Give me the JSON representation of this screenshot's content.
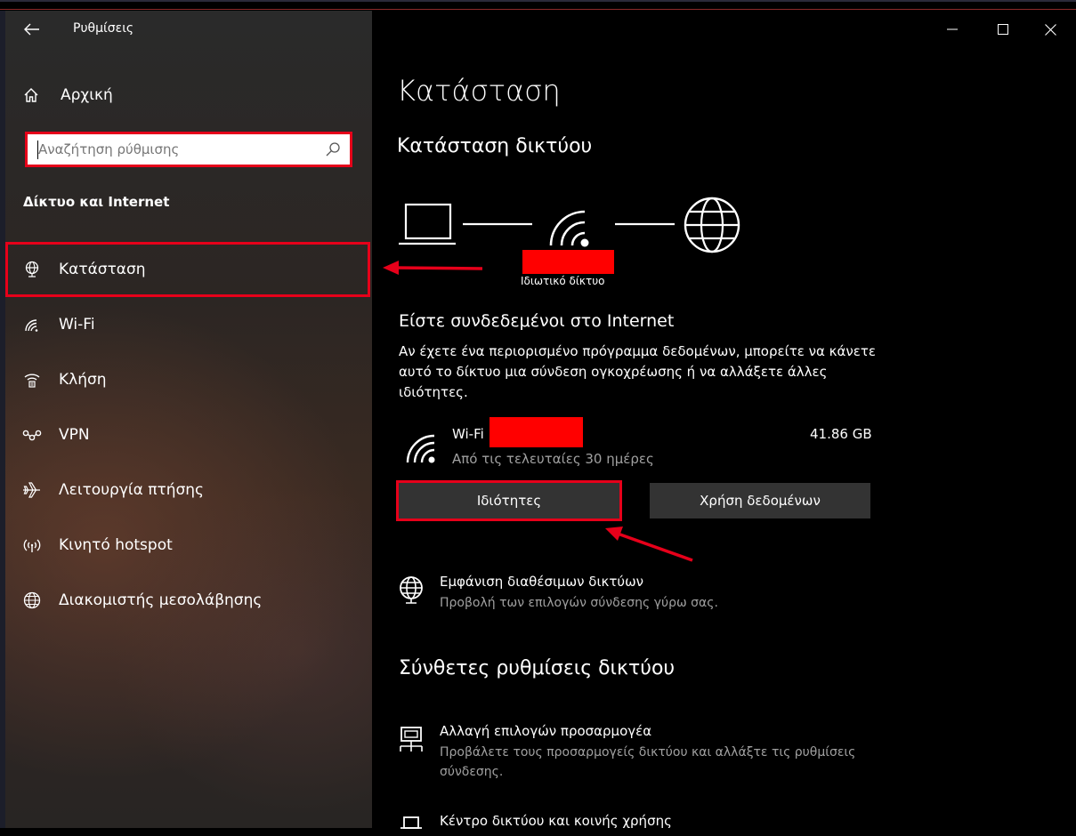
{
  "window": {
    "title": "Ρυθμίσεις",
    "controls": [
      "minimize-icon",
      "maximize-icon",
      "close-icon"
    ]
  },
  "sidebar": {
    "home_label": "Αρχική",
    "search_placeholder": "Αναζήτηση ρύθμισης",
    "section_header": "Δίκτυο και Internet",
    "items": [
      {
        "label": "Κατάσταση",
        "icon": "status-globe-icon",
        "active": true
      },
      {
        "label": "Wi-Fi",
        "icon": "wifi-icon"
      },
      {
        "label": "Κλήση",
        "icon": "dialup-icon"
      },
      {
        "label": "VPN",
        "icon": "vpn-icon"
      },
      {
        "label": "Λειτουργία πτήσης",
        "icon": "airplane-icon"
      },
      {
        "label": "Κινητό hotspot",
        "icon": "hotspot-icon"
      },
      {
        "label": "Διακομιστής μεσολάβησης",
        "icon": "proxy-globe-icon"
      }
    ]
  },
  "main": {
    "page_title": "Κατάσταση",
    "network_status_title": "Κατάσταση δικτύου",
    "network_type_label": "Ιδιωτικό δίκτυο",
    "connected_title": "Είστε συνδεδεμένοι στο Internet",
    "connected_desc": "Αν έχετε ένα περιορισμένο πρόγραμμα δεδομένων, μπορείτε να κάνετε αυτό το δίκτυο μια σύνδεση ογκοχρέωσης ή να αλλάξετε άλλες ιδιότητες.",
    "connection": {
      "name": "Wi-Fi",
      "period": "Από τις τελευταίες 30 ημέρες",
      "usage": "41.86 GB"
    },
    "buttons": {
      "properties": "Ιδιότητες",
      "data_usage": "Χρήση δεδομένων"
    },
    "show_networks": {
      "title": "Εμφάνιση διαθέσιμων δικτύων",
      "subtitle": "Προβολή των επιλογών σύνδεσης γύρω σας."
    },
    "advanced_title": "Σύνθετες ρυθμίσεις δικτύου",
    "adapter_options": {
      "title": "Αλλαγή επιλογών προσαρμογέα",
      "subtitle": "Προβάλετε τους προσαρμογείς δικτύου και αλλάξτε τις ρυθμίσεις σύνδεσης."
    },
    "sharing_center": {
      "title": "Κέντρο δικτύου και κοινής χρήσης"
    }
  },
  "colors": {
    "highlight": "#e6001a",
    "button_bg": "#333333",
    "secondary_text": "#a0a0a0"
  }
}
